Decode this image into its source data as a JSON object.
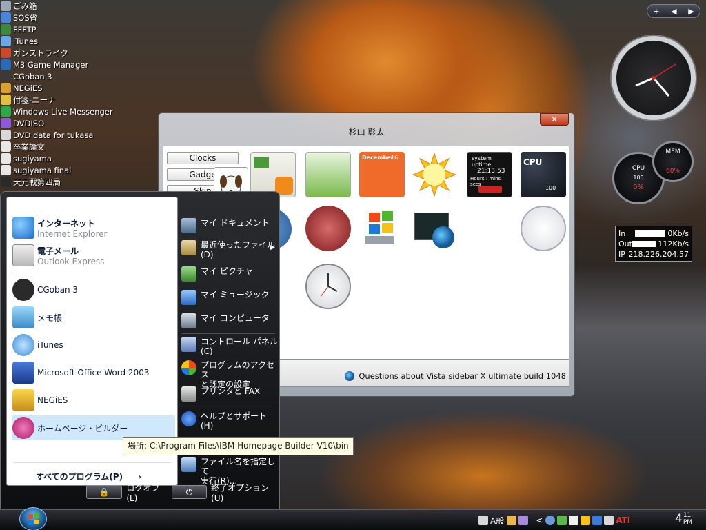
{
  "desktop": {
    "icons": [
      {
        "label": "ごみ箱",
        "color": "#9aa8b8"
      },
      {
        "label": "SOS省",
        "color": "#4a86d8"
      },
      {
        "label": "FFFTP",
        "color": "#3a8a3a"
      },
      {
        "label": "iTunes",
        "color": "#6aa8e8"
      },
      {
        "label": "ガンストライク",
        "color": "#c84a2a"
      },
      {
        "label": "M3 Game Manager",
        "color": "#2a6ab8"
      },
      {
        "label": "CGoban 3",
        "color": "#3a3a3a"
      },
      {
        "label": "NEGiES",
        "color": "#d8a030"
      },
      {
        "label": "付箋-ニーナ",
        "color": "#e0c040"
      },
      {
        "label": "Windows Live Messenger",
        "color": "#2aa84a"
      },
      {
        "label": "DVDISO",
        "color": "#8a5ad8"
      },
      {
        "label": "DVD data for tukasa",
        "color": "#d8d8d8"
      },
      {
        "label": "卒業論文",
        "color": "#e8e8e8"
      },
      {
        "label": "sugiyama",
        "color": "#e8e8e8"
      },
      {
        "label": "sugiyama final",
        "color": "#e8e8e8"
      },
      {
        "label": "天元戦第四局",
        "color": "#2a2a2a"
      }
    ]
  },
  "sidebar": {
    "nav_plus": "+",
    "nav_prev": "◀",
    "nav_next": "▶",
    "cpu_label": "CPU",
    "cpu_value": "0%",
    "cpu_scale": "100",
    "mem_label": "MEM",
    "mem_value": "60%",
    "net": {
      "in_label": "In",
      "in_value": "0Kb/s",
      "out_label": "Out",
      "out_value": "112Kb/s",
      "ip_label": "IP",
      "ip_value": "218.226.204.57"
    }
  },
  "gadget_window": {
    "title": "杉山 彰太",
    "close": "✕",
    "categories": [
      "Clocks",
      "Gadge",
      "Skin"
    ],
    "questions_link": "Questions about Vista sidebar X ultimate build 1048",
    "calendar_label": "December",
    "calendar_day": "16",
    "uptime_title": "system uptime",
    "uptime_value": "21:13:53",
    "uptime_unit": "Hours : mins : secs",
    "cpu_gadget_label": "CPU",
    "cpu_gadget_scale": "100"
  },
  "start_menu": {
    "pinned": [
      {
        "title": "インターネット",
        "subtitle": "Internet Explorer",
        "icon": "ie-icon"
      },
      {
        "title": "電子メール",
        "subtitle": "Outlook Express",
        "icon": "mail-icon"
      }
    ],
    "recent": [
      {
        "label": "CGoban 3",
        "icon": "cgoban-icon"
      },
      {
        "label": "メモ帳",
        "icon": "notepad-icon"
      },
      {
        "label": "iTunes",
        "icon": "itunes-icon"
      },
      {
        "label": "Microsoft Office Word 2003",
        "icon": "word-icon"
      },
      {
        "label": "NEGiES",
        "icon": "negies-icon"
      },
      {
        "label": "ホームページ・ビルダー",
        "icon": "homepage-builder-icon"
      }
    ],
    "all_programs": "すべてのプログラム(P)",
    "right": [
      {
        "label": "マイ ドキュメント"
      },
      {
        "label": "最近使ったファイル",
        "sub": "(D)"
      },
      {
        "label": "マイ ピクチャ"
      },
      {
        "label": "マイ ミュージック"
      },
      {
        "label": "マイ コンピュータ"
      },
      {
        "label": "コントロール パネル",
        "sub": "(C)"
      },
      {
        "label": "プログラムのアクセス",
        "sub": "と既定の設定"
      },
      {
        "label": "プリンタと FAX"
      },
      {
        "label": "ヘルプとサポート(H)"
      },
      {
        "label": "ファイル名を指定して",
        "sub": "実行(R)..."
      }
    ],
    "logoff": "ログオフ(L)",
    "shutdown": "終了オプション(U)",
    "tooltip": "場所: C:\\Program Files\\IBM Homepage Builder V10\\bin"
  },
  "taskbar": {
    "ime": "A般",
    "tray_arrow": "<",
    "ati": "ATi",
    "clock_hour": "4",
    "clock_min": "11",
    "clock_ampm": "PM"
  }
}
